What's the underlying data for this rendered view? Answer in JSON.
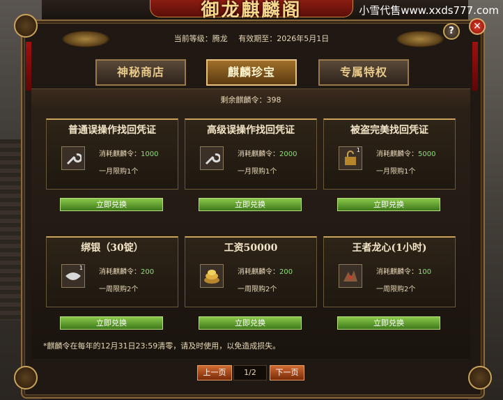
{
  "window": {
    "title": "御龙麒麟阁",
    "watermark": "小雪代售www.xxds777.com"
  },
  "header": {
    "level_label": "当前等级：腾龙",
    "expiry_label": "有效期至：2026年5月1日",
    "help": "?",
    "close": "✕"
  },
  "tabs": [
    {
      "label": "神秘商店",
      "active": false
    },
    {
      "label": "麒麟珍宝",
      "active": true
    },
    {
      "label": "专属特权",
      "active": false
    }
  ],
  "remaining": "剩余麒麟令：398",
  "items": [
    {
      "title": "普通误操作找回凭证",
      "icon": "wrench-icon",
      "cost_label": "消耗麒麟令：",
      "cost": "1000",
      "limit": "一月限购1个",
      "button": "立即兑换"
    },
    {
      "title": "高级误操作找回凭证",
      "icon": "wrench-icon",
      "cost_label": "消耗麒麟令：",
      "cost": "2000",
      "limit": "一月限购1个",
      "button": "立即兑换"
    },
    {
      "title": "被盗完美找回凭证",
      "icon": "lock-icon",
      "icon_count": "1",
      "cost_label": "消耗麒麟令：",
      "cost": "5000",
      "limit": "一月限购1个",
      "button": "立即兑换"
    },
    {
      "title": "绑银（30锭）",
      "icon": "silver-ingot-icon",
      "icon_count": "1",
      "cost_label": "消耗麒麟令：",
      "cost": "200",
      "limit": "一周限购2个",
      "button": "立即兑换"
    },
    {
      "title": "工资50000",
      "icon": "gold-coins-icon",
      "cost_label": "消耗麒麟令：",
      "cost": "200",
      "limit": "一周限购2个",
      "button": "立即兑换"
    },
    {
      "title": "王者龙心(1小时)",
      "icon": "dragon-heart-icon",
      "cost_label": "消耗麒麟令：",
      "cost": "100",
      "limit": "一周限购2个",
      "button": "立即兑换"
    }
  ],
  "note": "*麒麟令在每年的12月31日23:59清零，请及时使用，以免造成损失。",
  "pagination": {
    "prev": "上一页",
    "page": "1/2",
    "next": "下一页"
  },
  "colors": {
    "accent_gold": "#c9a45a",
    "cost_green": "#8ee07a",
    "button_green": "#5a9a2a",
    "page_orange": "#b04a18"
  }
}
